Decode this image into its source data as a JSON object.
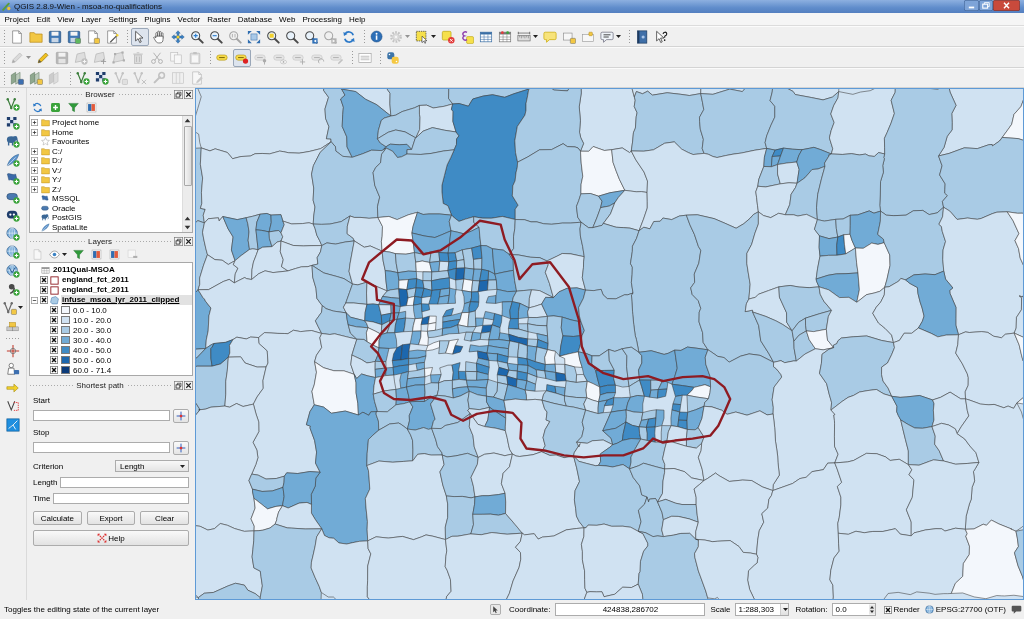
{
  "window": {
    "title": "QGIS 2.8.9-Wien - msoa-no-qualifications"
  },
  "menu": [
    "Project",
    "Edit",
    "View",
    "Layer",
    "Settings",
    "Plugins",
    "Vector",
    "Raster",
    "Database",
    "Web",
    "Processing",
    "Help"
  ],
  "toolbars": [
    {
      "groups": [
        [
          {
            "kind": "new",
            "disabled": false,
            "selected": false
          },
          {
            "kind": "open",
            "disabled": false,
            "selected": false
          },
          {
            "kind": "save",
            "disabled": false,
            "selected": false
          },
          {
            "kind": "saveas",
            "disabled": false,
            "selected": false
          },
          {
            "kind": "composer",
            "disabled": false,
            "selected": false
          },
          {
            "kind": "composers",
            "disabled": false,
            "selected": false
          }
        ],
        [
          {
            "kind": "touch",
            "disabled": false,
            "selected": true
          },
          {
            "kind": "pan",
            "disabled": false,
            "selected": false
          },
          {
            "kind": "panselection",
            "disabled": false,
            "selected": false
          },
          {
            "kind": "zoomin",
            "disabled": false,
            "selected": false
          },
          {
            "kind": "zoomout",
            "disabled": false,
            "selected": false
          },
          {
            "kind": "zoomactual",
            "disabled": true,
            "selected": false
          },
          {
            "kind": "zoomfull",
            "disabled": false,
            "selected": false
          },
          {
            "kind": "zoomselection",
            "disabled": false,
            "selected": false
          },
          {
            "kind": "zoomlayer",
            "disabled": false,
            "selected": false
          },
          {
            "kind": "zoomlast",
            "disabled": false,
            "selected": false
          },
          {
            "kind": "zoomnext",
            "disabled": true,
            "selected": false
          },
          {
            "kind": "refresh",
            "disabled": false,
            "selected": false
          }
        ],
        [
          {
            "kind": "identify",
            "disabled": false,
            "selected": false
          },
          {
            "kind": "action",
            "disabled": true,
            "selected": false
          },
          {
            "kind": "select",
            "disabled": false,
            "selected": false
          },
          {
            "kind": "deselect",
            "disabled": false,
            "selected": false
          },
          {
            "kind": "expression",
            "disabled": false,
            "selected": false
          },
          {
            "kind": "table",
            "disabled": false,
            "selected": false
          },
          {
            "kind": "statistics",
            "disabled": false,
            "selected": false
          },
          {
            "kind": "measure",
            "disabled": false,
            "selected": false
          },
          {
            "kind": "maptips",
            "disabled": false,
            "selected": false
          },
          {
            "kind": "bookmark",
            "disabled": false,
            "selected": false
          },
          {
            "kind": "bookmarks",
            "disabled": false,
            "selected": false
          },
          {
            "kind": "annotation",
            "disabled": false,
            "selected": false
          }
        ],
        [
          {
            "kind": "helpbook",
            "disabled": false,
            "selected": false
          },
          {
            "kind": "whatsthis",
            "disabled": false,
            "selected": false
          }
        ]
      ]
    },
    {
      "groups": [
        [
          {
            "kind": "edits",
            "disabled": true,
            "selected": false
          },
          {
            "kind": "pencil",
            "disabled": false,
            "selected": false
          },
          {
            "kind": "saveedits",
            "disabled": true,
            "selected": false
          },
          {
            "kind": "addfeature",
            "disabled": true,
            "selected": false
          },
          {
            "kind": "movefeature",
            "disabled": true,
            "selected": false
          },
          {
            "kind": "nodetool",
            "disabled": true,
            "selected": false
          },
          {
            "kind": "deletesel",
            "disabled": true,
            "selected": false
          },
          {
            "kind": "cut",
            "disabled": true,
            "selected": false
          },
          {
            "kind": "copy",
            "disabled": true,
            "selected": false
          },
          {
            "kind": "paste",
            "disabled": true,
            "selected": false
          }
        ],
        [
          {
            "kind": "label",
            "disabled": false,
            "selected": false
          },
          {
            "kind": "labelhighlight",
            "disabled": false,
            "selected": true
          },
          {
            "kind": "labelpin",
            "disabled": true,
            "selected": false
          },
          {
            "kind": "labelshow",
            "disabled": true,
            "selected": false
          },
          {
            "kind": "labelmove",
            "disabled": true,
            "selected": false
          },
          {
            "kind": "labelrotate",
            "disabled": true,
            "selected": false
          },
          {
            "kind": "labelchange",
            "disabled": true,
            "selected": false
          }
        ],
        [
          {
            "kind": "csv",
            "disabled": false,
            "selected": false
          }
        ],
        [
          {
            "kind": "python",
            "disabled": false,
            "selected": false
          }
        ]
      ]
    },
    {
      "groups": [
        [
          {
            "kind": "stackblue",
            "disabled": false
          },
          {
            "kind": "stackyellow",
            "disabled": false
          },
          {
            "kind": "stack",
            "disabled": true
          }
        ],
        [
          {
            "kind": "vplus",
            "disabled": false
          },
          {
            "kind": "checkerplus",
            "disabled": false
          },
          {
            "kind": "vgrey",
            "disabled": true
          },
          {
            "kind": "vcross",
            "disabled": true
          },
          {
            "kind": "tool",
            "disabled": true
          },
          {
            "kind": "columns",
            "disabled": true
          },
          {
            "kind": "pagepencil",
            "disabled": true
          }
        ]
      ]
    }
  ],
  "side_toolbar": {
    "groups": [
      [
        {
          "kind": "addvector",
          "disabled": false
        },
        {
          "kind": "addraster",
          "disabled": false
        },
        {
          "kind": "addpostgis",
          "disabled": false
        },
        {
          "kind": "addspatialite",
          "disabled": false
        },
        {
          "kind": "addmssql",
          "disabled": false
        },
        {
          "kind": "addoracle",
          "disabled": false
        },
        {
          "kind": "adddb2",
          "disabled": false
        },
        {
          "kind": "addwms",
          "disabled": false
        },
        {
          "kind": "addwcs",
          "disabled": false
        },
        {
          "kind": "addwfs",
          "disabled": false
        },
        {
          "kind": "adddelimited",
          "disabled": false
        },
        {
          "kind": "newlayer",
          "disabled": false
        },
        {
          "kind": "addvirtual",
          "disabled": false
        }
      ],
      [
        {
          "kind": "roadpin",
          "disabled": false
        },
        {
          "kind": "roadpoint",
          "disabled": false
        },
        {
          "kind": "roadflag",
          "disabled": false
        },
        {
          "kind": "roadgraph",
          "disabled": false
        },
        {
          "kind": "roadpanel",
          "disabled": false
        }
      ]
    ]
  },
  "browser": {
    "title": "Browser",
    "tools": [
      {
        "kind": "refresh"
      },
      {
        "kind": "add"
      },
      {
        "kind": "filter"
      },
      {
        "kind": "collapse"
      }
    ],
    "items": [
      {
        "name": "Project home",
        "kind": "folder",
        "expanded": false
      },
      {
        "name": "Home",
        "kind": "folder",
        "expanded": false
      },
      {
        "name": "Favourites",
        "kind": "star"
      },
      {
        "name": "C:/",
        "kind": "folder",
        "expanded": false
      },
      {
        "name": "D:/",
        "kind": "folder",
        "expanded": false
      },
      {
        "name": "V:/",
        "kind": "folder",
        "expanded": false
      },
      {
        "name": "Y:/",
        "kind": "folder",
        "expanded": false
      },
      {
        "name": "Z:/",
        "kind": "folder",
        "expanded": false
      },
      {
        "name": "MSSQL",
        "kind": "mssql"
      },
      {
        "name": "Oracle",
        "kind": "oracle"
      },
      {
        "name": "PostGIS",
        "kind": "postgis"
      },
      {
        "name": "SpatiaLite",
        "kind": "spatialite"
      }
    ]
  },
  "layers": {
    "title": "Layers",
    "tools": [
      {
        "kind": "style",
        "disabled": true
      },
      {
        "kind": "eye",
        "disabled": false
      },
      {
        "kind": "filter",
        "disabled": false
      },
      {
        "kind": "expand",
        "disabled": false
      },
      {
        "kind": "collapse",
        "disabled": false
      },
      {
        "kind": "remove",
        "disabled": true
      }
    ],
    "items": [
      {
        "name": "2011Qual-MSOA",
        "kind": "table",
        "selected": false
      },
      {
        "name": "england_fct_2011",
        "kind": "outline",
        "checked": true,
        "selected": false
      },
      {
        "name": "england_fct_2011",
        "kind": "outline",
        "checked": true,
        "selected": false
      },
      {
        "name": "infuse_msoa_lyr_2011_clipped",
        "kind": "polygon",
        "checked": true,
        "selected": true,
        "expanded": true,
        "children": [
          {
            "label": "0.0 - 10.0",
            "color": "#f3f7fc",
            "checked": true
          },
          {
            "label": "10.0 - 20.0",
            "color": "#d0e2f2",
            "checked": true
          },
          {
            "label": "20.0 - 30.0",
            "color": "#a9cbe5",
            "checked": true
          },
          {
            "label": "30.0 - 40.0",
            "color": "#71abd6",
            "checked": true
          },
          {
            "label": "40.0 - 50.0",
            "color": "#3f8bc5",
            "checked": true
          },
          {
            "label": "50.0 - 60.0",
            "color": "#1d67ad",
            "checked": true
          },
          {
            "label": "60.0 - 71.4",
            "color": "#0b3b7a",
            "checked": true
          }
        ]
      }
    ]
  },
  "shortest_path": {
    "title": "Shortest path",
    "start": {
      "label": "Start"
    },
    "stop": {
      "label": "Stop"
    },
    "criterion": {
      "label": "Criterion",
      "value": "Length"
    },
    "length": {
      "label": "Length"
    },
    "time": {
      "label": "Time"
    },
    "buttons": [
      "Calculate",
      "Export",
      "Clear"
    ],
    "help": "Help"
  },
  "status_bar": {
    "message": "Toggles the editing state of the current layer",
    "coordinate_label": "Coordinate:",
    "coordinate": "424838,286702",
    "scale_label": "Scale",
    "scale": "1:288,303",
    "rotation_label": "Rotation:",
    "rotation": "0.0",
    "render": {
      "label": "Render",
      "checked": true
    },
    "crs": "EPSG:27700 (OTF)"
  }
}
